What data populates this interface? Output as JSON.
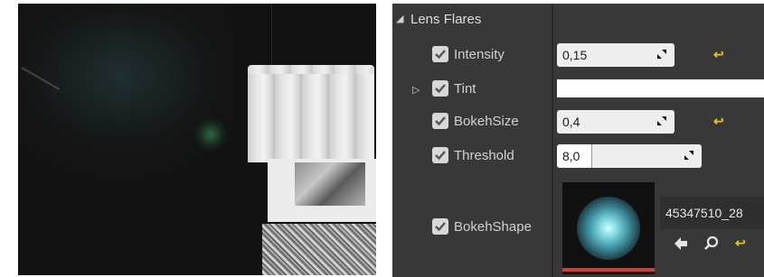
{
  "category": {
    "label": "Lens Flares",
    "arrow_icon": "triangle-down-icon"
  },
  "properties": {
    "intensity": {
      "label": "Intensity",
      "value": "0,15",
      "checked": true
    },
    "tint": {
      "label": "Tint",
      "checked": true,
      "color": "#ffffff"
    },
    "bokeh_size": {
      "label": "BokehSize",
      "value": "0,4",
      "checked": true
    },
    "threshold": {
      "label": "Threshold",
      "value": "8,0",
      "checked": true
    },
    "bokeh_shape": {
      "label": "BokehShape",
      "checked": true,
      "asset_name": "45347510_28"
    }
  },
  "icons": {
    "reset": "reset-to-default-icon",
    "spin": "spin-arrows-icon",
    "use_selected": "left-arrow-icon",
    "browse": "search-icon"
  },
  "colors": {
    "panel_bg": "#383838",
    "accent_reset": "#e8c21a",
    "thumbnail_underline": "#d23c3c"
  }
}
